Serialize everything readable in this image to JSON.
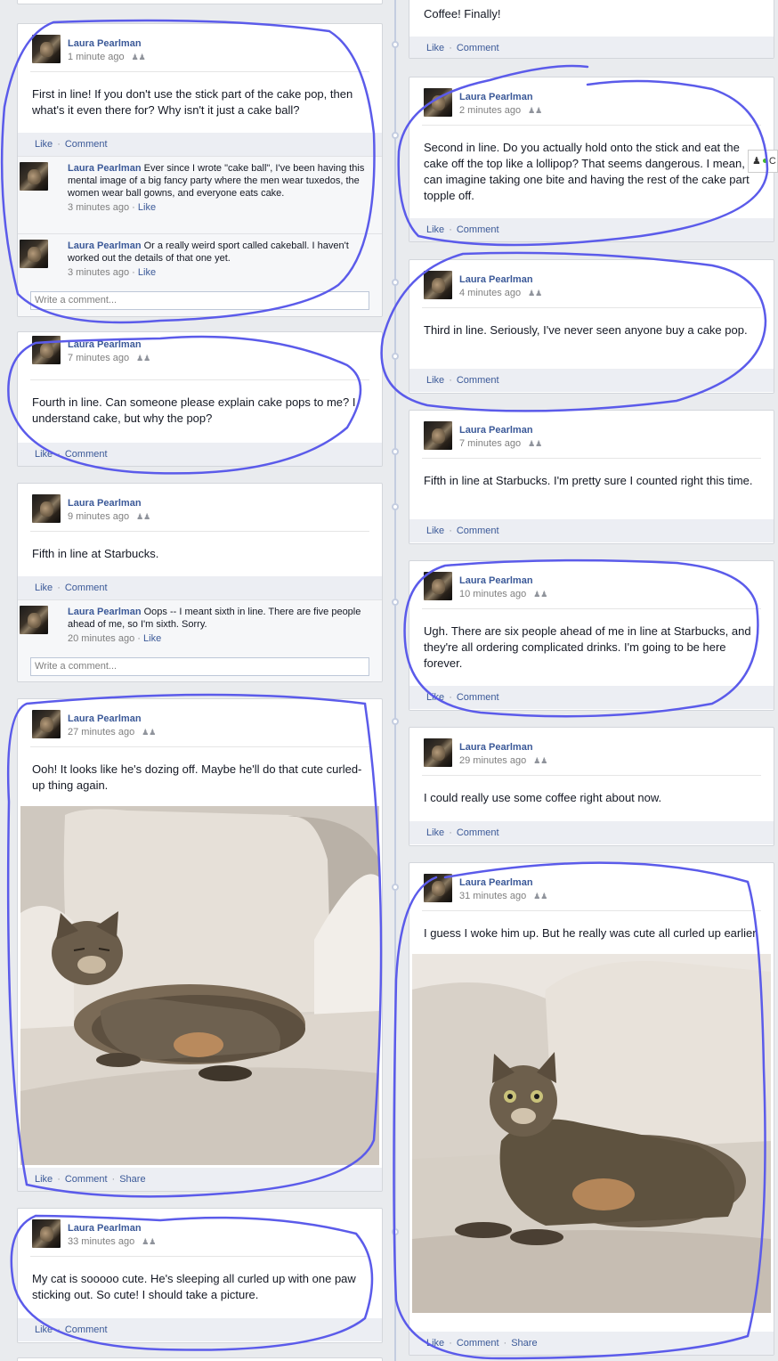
{
  "author": "Laura Pearlman",
  "actions": {
    "like": "Like",
    "comment": "Comment",
    "share": "Share",
    "sep": "·"
  },
  "write_placeholder": "Write a comment...",
  "audience_icon": "friends-icon",
  "chat": {
    "label": "C",
    "icon": "friends-online-icon",
    "status_color": "#42b72a"
  },
  "colors": {
    "link": "#3b5998",
    "background": "#e9ebee",
    "annotation": "#5b5bea"
  },
  "left_posts": [
    {
      "time": "1 minute ago",
      "text": "First in line! If you don't use the stick part of the cake pop, then what's it even there for? Why isn't it just a cake ball?"
    },
    {
      "time": "7 minutes ago",
      "text": "Fourth in line. Can someone please explain cake pops to me? I understand cake, but why the pop?"
    },
    {
      "time": "9 minutes ago",
      "text": "Fifth in line at Starbucks."
    },
    {
      "time": "27 minutes ago",
      "text": "Ooh! It looks like he's dozing off. Maybe he'll do that cute curled-up thing again.",
      "photo": "sleeping tabby cat on a white couch"
    },
    {
      "time": "33 minutes ago",
      "text": "My cat is sooooo cute. He's sleeping all curled up with one paw sticking out. So cute! I should take a picture."
    }
  ],
  "right_posts": [
    {
      "time": "",
      "text": "Coffee! Finally!"
    },
    {
      "time": "2 minutes ago",
      "text": "Second in line. Do you actually hold onto the stick and eat the cake off the top like a lollipop? That seems dangerous. I mean, I can imagine taking one bite and having the rest of the cake part topple off."
    },
    {
      "time": "4 minutes ago",
      "text": "Third in line. Seriously, I've never seen anyone buy a cake pop."
    },
    {
      "time": "7 minutes ago",
      "text": "Fifth in line at Starbucks. I'm pretty sure I counted right this time."
    },
    {
      "time": "10 minutes ago",
      "text": "Ugh. There are six people ahead of me in line at Starbucks, and they're all ordering complicated drinks. I'm going to be here forever."
    },
    {
      "time": "29 minutes ago",
      "text": "I could really use some coffee right about now."
    },
    {
      "time": "31 minutes ago",
      "text": "I guess I woke him up. But he really was cute all curled up earlier.",
      "photo": "alert tabby cat on a white couch"
    }
  ],
  "comments": {
    "post1": [
      {
        "text": "Ever since I wrote \"cake ball\", I've been having this mental image of a big fancy party where the men wear tuxedos, the women wear ball gowns, and everyone eats cake.",
        "time": "3 minutes ago"
      },
      {
        "text": "Or a really weird sport called cakeball. I haven't worked out the details of that one yet.",
        "time": "3 minutes ago"
      }
    ],
    "post3": [
      {
        "text": "Oops -- I meant sixth in line. There are five people ahead of me, so I'm sixth. Sorry.",
        "time": "20 minutes ago"
      }
    ]
  }
}
